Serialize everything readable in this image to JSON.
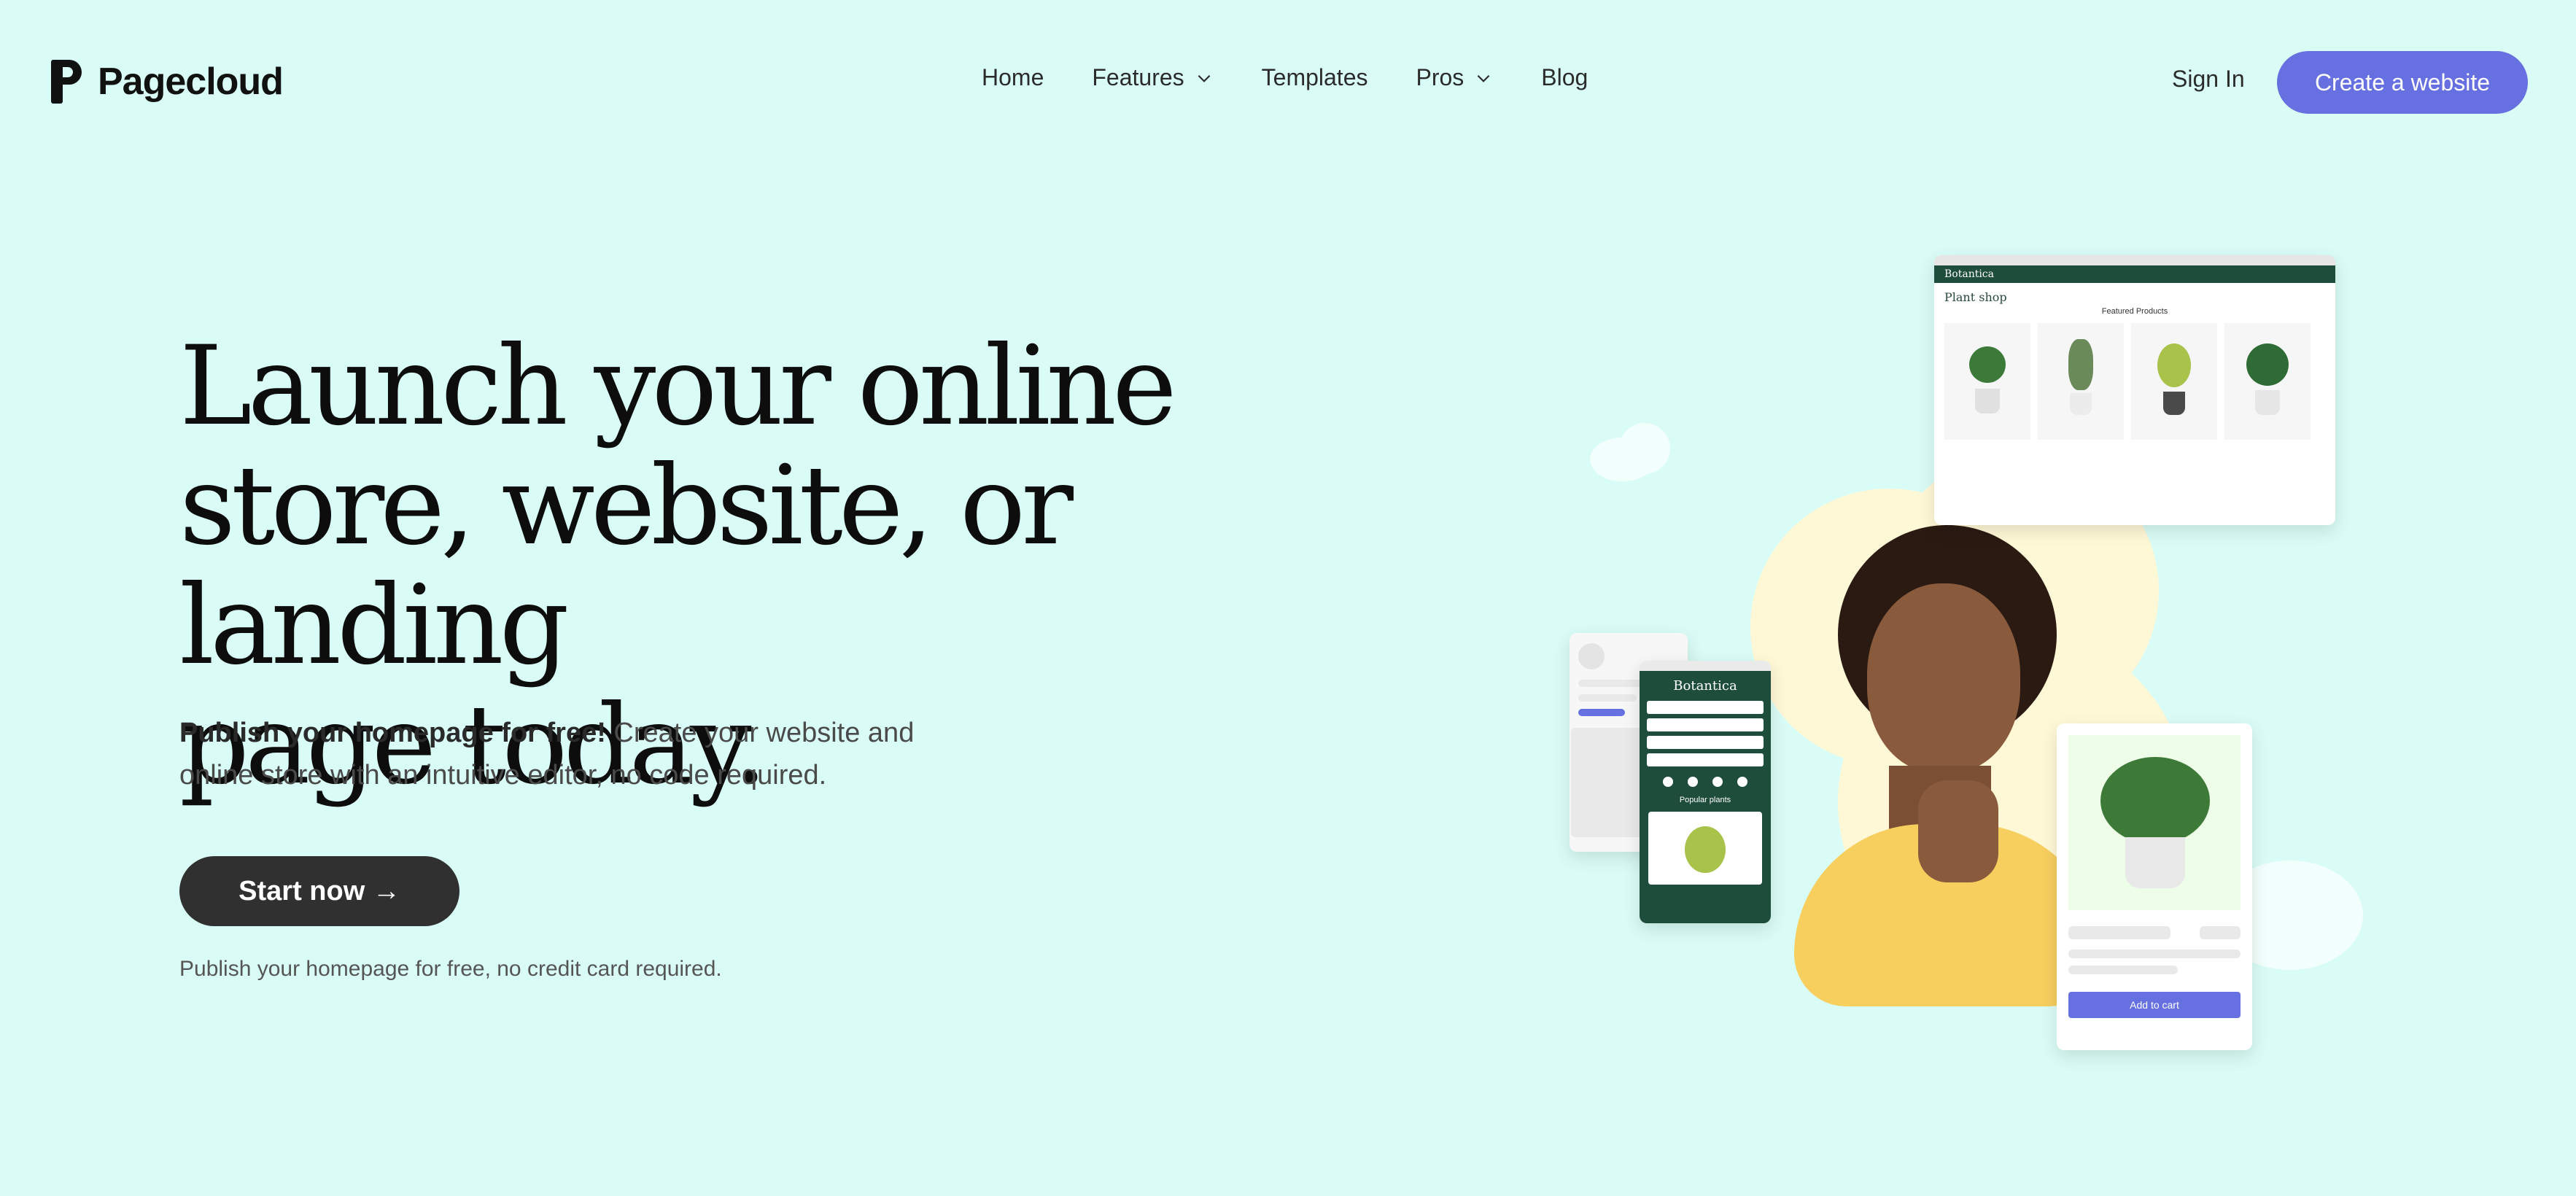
{
  "brand": {
    "name": "Pagecloud",
    "icon": "pagecloud-logo-icon"
  },
  "nav": [
    {
      "label": "Home",
      "has_dropdown": false
    },
    {
      "label": "Features",
      "has_dropdown": true
    },
    {
      "label": "Templates",
      "has_dropdown": false
    },
    {
      "label": "Pros",
      "has_dropdown": true
    },
    {
      "label": "Blog",
      "has_dropdown": false
    }
  ],
  "header": {
    "signin_label": "Sign In",
    "cta_label": "Create a website"
  },
  "hero": {
    "headline_line1": "Launch your online",
    "headline_line2": "store, website, or landing",
    "headline_line3": "page today.",
    "sub_bold": "Publish your homepage for free!",
    "sub_rest": " Create your website and online store with an intuitive editor, no code required.",
    "start_label": "Start now →",
    "fineprint": "Publish your homepage for free, no credit card required."
  },
  "illustration": {
    "desktop_brand": "Botantica",
    "desktop_title": "Plant shop",
    "desktop_section": "Featured Products",
    "mobile_brand": "Botantica",
    "mobile_section": "Popular plants",
    "product_button": "Add to cart"
  },
  "colors": {
    "background": "#dafcf6",
    "accent": "#6670e0",
    "dark_button": "#303030",
    "botantica_green": "#1f4d3c"
  }
}
